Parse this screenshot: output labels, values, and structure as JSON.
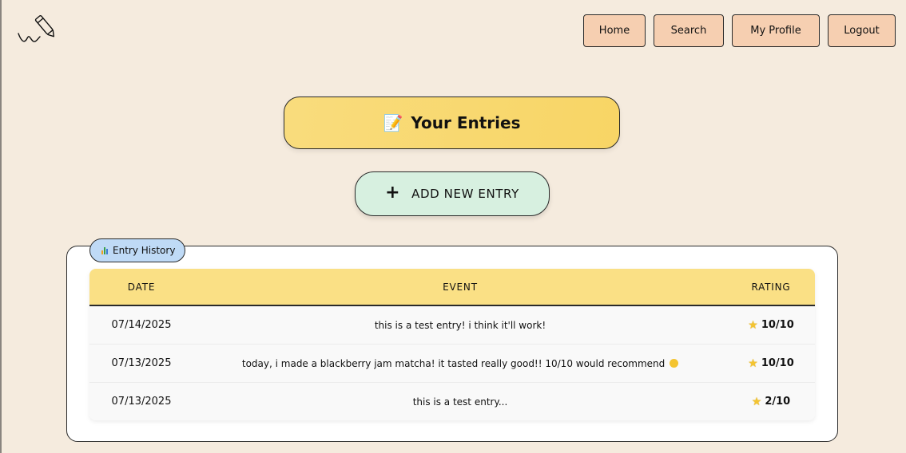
{
  "logo": {
    "icon": "pen-signature-icon"
  },
  "nav": {
    "home": "Home",
    "search": "Search",
    "profile": "My Profile",
    "logout": "Logout"
  },
  "title": {
    "icon": "memo-icon",
    "text": "Your Entries"
  },
  "add_entry": {
    "icon": "plus-icon",
    "label": "ADD NEW ENTRY"
  },
  "history": {
    "tag_icon": "bar-chart-icon",
    "tag_label": "Entry History",
    "columns": {
      "date": "DATE",
      "event": "EVENT",
      "rating": "RATING"
    },
    "rows": [
      {
        "date": "07/14/2025",
        "event": "this is a test entry! i think it'll work!",
        "rating": "10/10"
      },
      {
        "date": "07/13/2025",
        "event": "today, i made a blackberry jam matcha! it tasted really good!! 10/10 would recommend",
        "rating": "10/10"
      },
      {
        "date": "07/13/2025",
        "event": "this is a test entry...",
        "rating": "2/10"
      }
    ]
  },
  "colors": {
    "background": "#f5ebde",
    "nav_button": "#f6cfb1",
    "title_banner": "#f8d565",
    "add_button": "#d7f0e0",
    "table_header": "#fae085",
    "history_tag": "#bfdaf6"
  }
}
